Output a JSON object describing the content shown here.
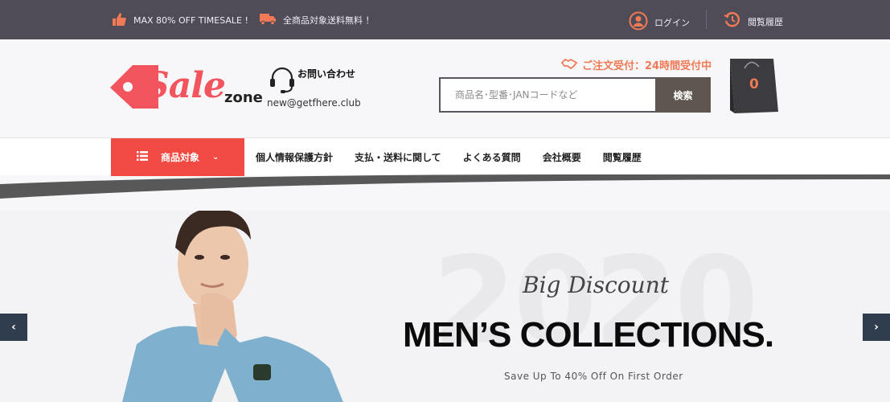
{
  "topbar": {
    "sale": "MAX 80% OFF TIMESALE !",
    "shipping": "全商品対象送料無料 ！",
    "login": "ログイン",
    "history": "閲覧履歴"
  },
  "header": {
    "logo_sale": "Sale",
    "logo_zone": "zone",
    "contact_label": "お問い合わせ",
    "contact_email": "new@getfhere.club",
    "order_hours": "ご注文受付：24時間受付中",
    "search_placeholder": "商品名･型番･JANコードなど",
    "search_button": "検索",
    "cart_count": "0"
  },
  "nav": {
    "category": "商品対象",
    "links": [
      "個人情報保護方針",
      "支払・送料に関して",
      "よくある質問",
      "会社概要",
      "閲覧履歴"
    ]
  },
  "hero": {
    "year": "2020",
    "script_title": "Big Discount",
    "headline": "MEN’S COLLECTIONS.",
    "subline": "Save Up To 40% Off On First Order",
    "prev": "‹",
    "next": "›"
  },
  "colors": {
    "topbar": "#4f4b57",
    "accent_red": "#f04a43",
    "accent_orange": "#f07a56",
    "search_button": "#5f564f",
    "slider_arrow": "#2f3d4f"
  },
  "icons": [
    "thumbs-up-icon",
    "truck-icon",
    "user-icon",
    "history-icon",
    "headset-icon",
    "handshake-icon",
    "shopping-bag-icon",
    "menu-list-icon",
    "chevron-down-icon"
  ]
}
